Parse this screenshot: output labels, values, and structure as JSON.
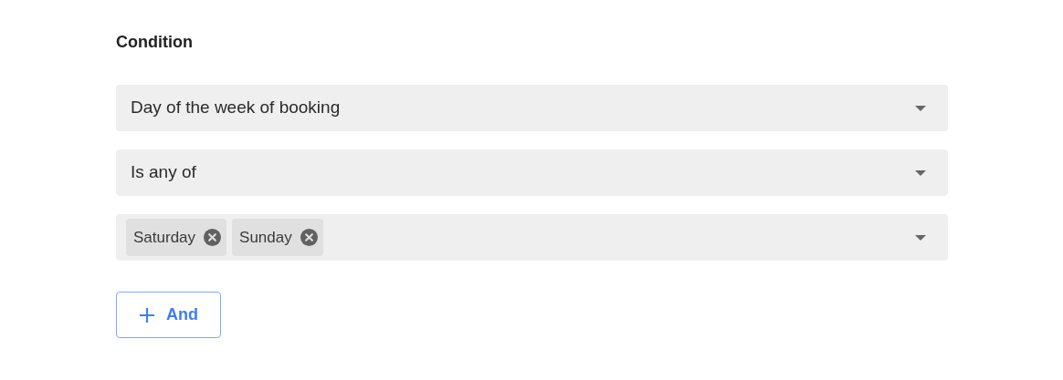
{
  "heading": "Condition",
  "fields": [
    {
      "kind": "select",
      "value": "Day of the week of booking"
    },
    {
      "kind": "select",
      "value": "Is any of"
    },
    {
      "kind": "multiselect",
      "tags": [
        "Saturday",
        "Sunday"
      ]
    }
  ],
  "add_button": {
    "label": "And"
  }
}
